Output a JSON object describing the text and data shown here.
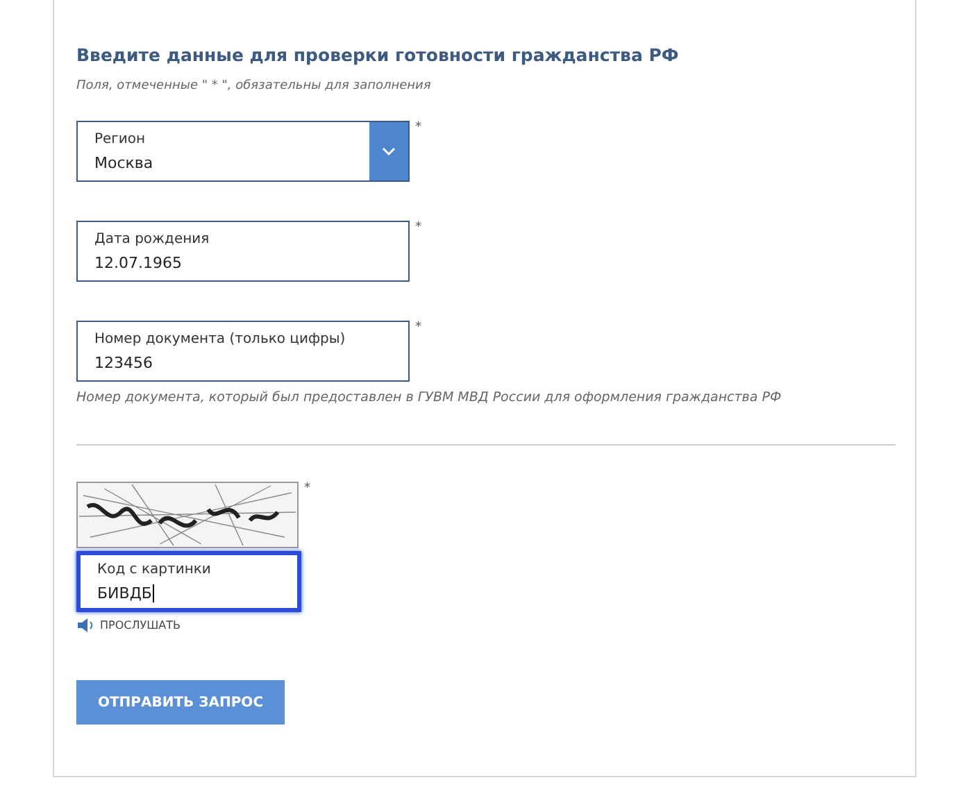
{
  "form": {
    "title": "Введите данные для проверки готовности гражданства РФ",
    "note": "Поля, отмеченные \" * \", обязательны для заполнения",
    "fields": [
      {
        "kind": "select",
        "label": "Регион",
        "value": "Москва",
        "required": "*",
        "focused": false
      },
      {
        "kind": "text",
        "label": "Дата рождения",
        "value": "12.07.1965",
        "required": "*",
        "focused": false
      },
      {
        "kind": "text",
        "label": "Номер документа (только цифры)",
        "value": "123456",
        "required": "*",
        "focused": false,
        "hint": "Номер документа, который был предоставлен в ГУВМ МВД России для оформления гражданства РФ"
      }
    ],
    "captcha": {
      "required": "*",
      "field": {
        "label": "Код с картинки",
        "value": "БИВДБ",
        "focused": true
      },
      "listen": "ПРОСЛУШАТЬ"
    },
    "submit": "ОТПРАВИТЬ ЗАПРОС"
  }
}
